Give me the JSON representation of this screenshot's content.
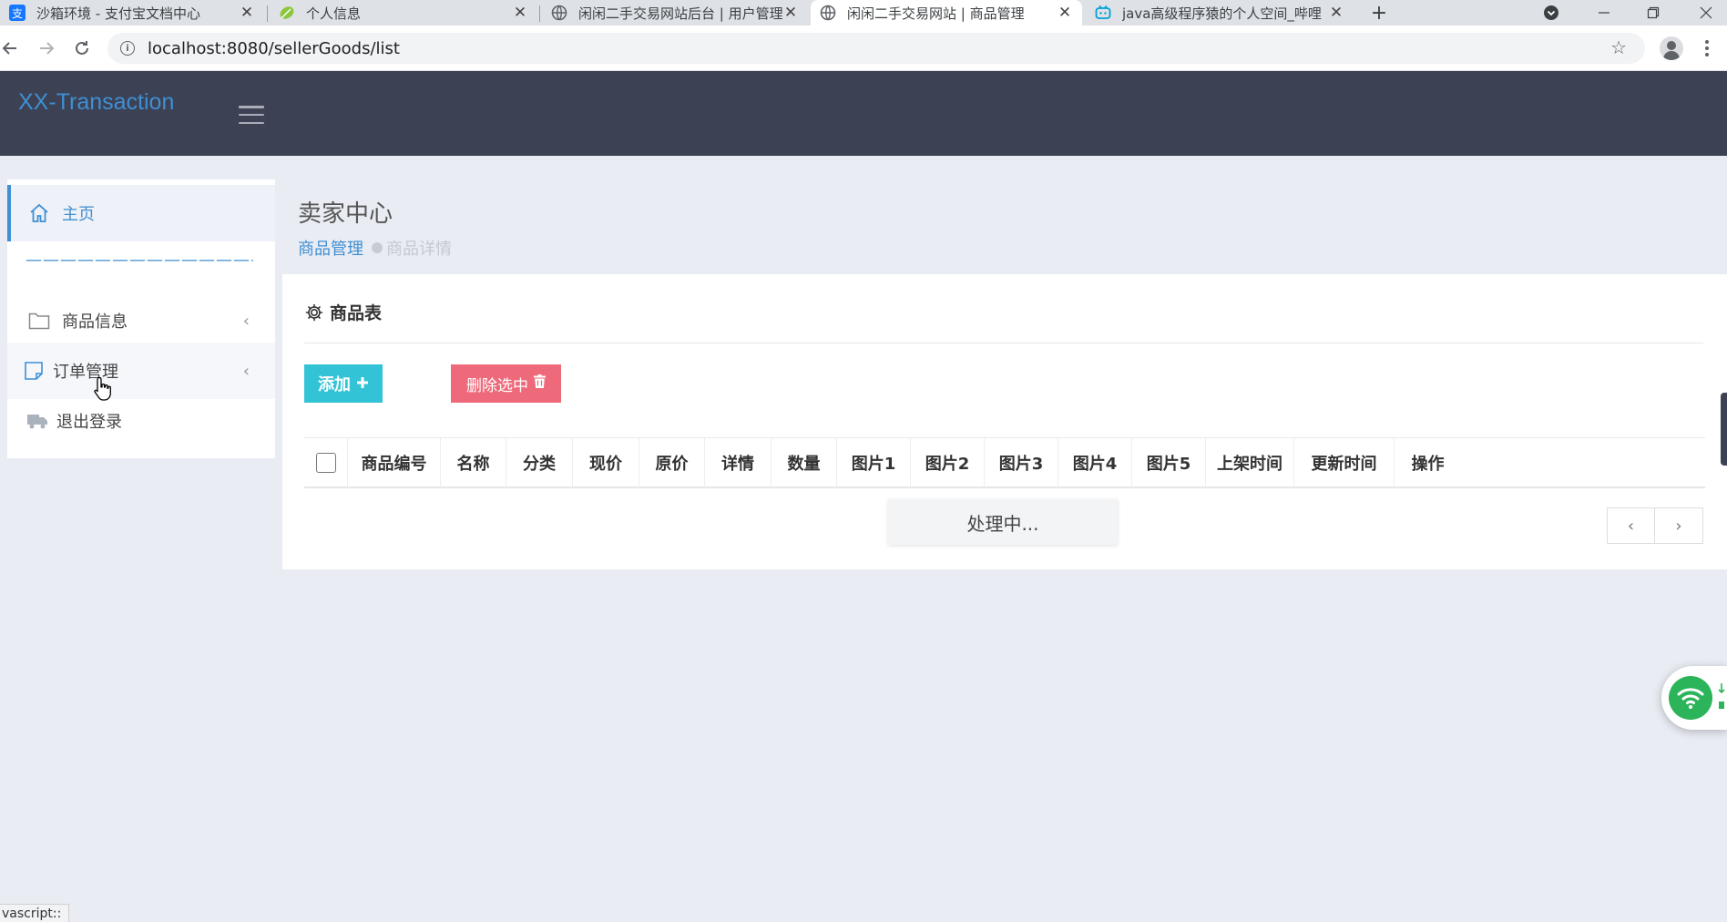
{
  "browser": {
    "tabs": [
      {
        "title": "沙箱环境 - 支付宝文档中心",
        "icon": "alipay-icon"
      },
      {
        "title": "个人信息",
        "icon": "leaf-icon"
      },
      {
        "title": "闲闲二手交易网站后台 | 用户管理",
        "icon": "globe-icon"
      },
      {
        "title": "闲闲二手交易网站 | 商品管理",
        "icon": "globe-icon",
        "active": true
      },
      {
        "title": "java高级程序猿的个人空间_哔哩",
        "icon": "bilibili-icon"
      }
    ],
    "url": "localhost:8080/sellerGoods/list",
    "status_tooltip": "vascript::"
  },
  "header": {
    "brand": "XX-Transaction"
  },
  "sidebar": {
    "items": [
      {
        "label": "主页",
        "icon": "home-icon"
      },
      {
        "label": "——————————————",
        "icon": ""
      },
      {
        "label": "商品信息",
        "icon": "folder-icon"
      },
      {
        "label": "订单管理",
        "icon": "note-icon"
      },
      {
        "label": "退出登录",
        "icon": "truck-icon"
      }
    ]
  },
  "page": {
    "title": "卖家中心",
    "breadcrumb": [
      "商品管理",
      "商品详情"
    ]
  },
  "panel": {
    "title": "商品表",
    "add_label": "添加",
    "delete_label": "删除选中",
    "columns": [
      "商品编号",
      "名称",
      "分类",
      "现价",
      "原价",
      "详情",
      "数量",
      "图片1",
      "图片2",
      "图片3",
      "图片4",
      "图片5",
      "上架时间",
      "更新时间",
      "操作"
    ],
    "processing": "处理中...",
    "pager": {
      "prev": "‹",
      "next": "›"
    }
  },
  "colors": {
    "header_bg": "#3c4154",
    "brand": "#3f8fd2",
    "add_button": "#32c3d6",
    "delete_button": "#ee6a7a",
    "page_bg": "#e9ecf3"
  }
}
